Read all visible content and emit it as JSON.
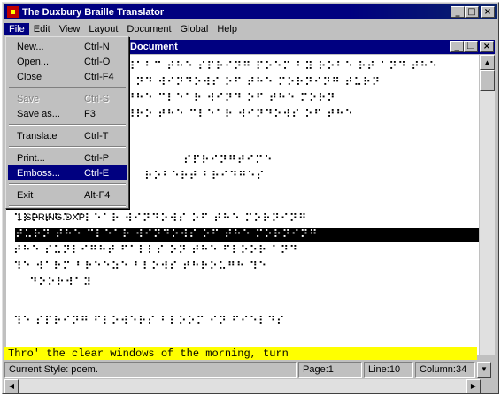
{
  "window": {
    "title": "The Duxbury Braille Translator",
    "minimize": "_",
    "maximize": "□",
    "close": "×"
  },
  "menubar": {
    "items": [
      "File",
      "Edit",
      "View",
      "Layout",
      "Document",
      "Global",
      "Help"
    ]
  },
  "file_menu": {
    "items": [
      {
        "label": "New...",
        "shortcut": "Ctrl-N",
        "state": "normal"
      },
      {
        "label": "Open...",
        "shortcut": "Ctrl-O",
        "state": "normal"
      },
      {
        "label": "Close",
        "shortcut": "Ctrl-F4",
        "state": "normal"
      },
      {
        "label": "Save",
        "shortcut": "Ctrl-S",
        "state": "disabled"
      },
      {
        "label": "Save as...",
        "shortcut": "F3",
        "state": "normal"
      },
      {
        "label": "Translate",
        "shortcut": "Ctrl-T",
        "state": "normal"
      },
      {
        "label": "Print...",
        "shortcut": "Ctrl-P",
        "state": "normal"
      },
      {
        "label": "Emboss...",
        "shortcut": "Ctrl-E",
        "state": "selected"
      },
      {
        "label": "Exit",
        "shortcut": "Alt-F4",
        "state": "normal"
      },
      {
        "label": "1 SPRING.DXP",
        "shortcut": "",
        "state": "normal"
      }
    ]
  },
  "document": {
    "title_suffix": "Document",
    "minimize": "_",
    "restore": "❐",
    "close": "×",
    "braille_lines": [
      "⠼⠁⠃⠉ ⠞⠓⠑ ⠎⠏⠗⠊⠝⠛ ⠏⠕⠑⠍ ⠃⠽ ⠗⠕⠃⠑ ⠗⠞ ⠁⠝⠙ ⠞⠓⠑",
      "⠁⠝⠙ ⠺⠊⠝⠙⠕⠺⠎ ⠕⠋ ⠞⠓⠑ ⠍⠕⠗⠝⠊⠝⠛ ⠞⠥⠗⠝",
      "⠞⠓⠑ ⠉⠇⠑⠁⠗ ⠺⠊⠝⠙ ⠕⠋ ⠞⠓⠑ ⠍⠕⠗⠝",
      "⠹⠗⠕ ⠞⠓⠑ ⠉⠇⠑⠁⠗ ⠺⠊⠝⠙⠕⠺⠎ ⠕⠋ ⠞⠓⠑",
      "⠎⠏⠗⠊⠝⠛⠞⠊⠍⠑",
      "⠗⠕⠃⠑⠗⠞ ⠃⠗⠊⠙⠛⠑⠎",
      "⠹⠗⠕ ⠞⠓⠑ ⠉⠇⠑⠁⠗ ⠺⠊⠝⠙⠕⠺⠎ ⠕⠋ ⠞⠓⠑ ⠍⠕⠗⠝⠊⠝⠛",
      "⠞⠥⠗⠝ ⠞⠓⠑ ⠉⠇⠑⠁⠗ ⠺⠊⠝⠙⠕⠺⠎ ⠕⠋ ⠞⠓⠑ ⠍⠕⠗⠝⠊⠝⠛",
      "⠞⠓⠑ ⠎⠥⠝⠇⠊⠛⠓⠞ ⠋⠁⠇⠇⠎ ⠕⠝ ⠞⠓⠑ ⠋⠇⠕⠕⠗ ⠁⠝⠙",
      "⠹⠑ ⠺⠁⠗⠍ ⠃⠗⠑⠑⠵⠑ ⠃⠇⠕⠺⠎ ⠞⠓⠗⠕⠥⠛⠓ ⠹⠑",
      "⠙⠕⠕⠗⠺⠁⠽",
      "⠹⠑ ⠎⠏⠗⠊⠝⠛ ⠋⠇⠕⠺⠑⠗⠎ ⠃⠇⠕⠕⠍ ⠊⠝ ⠋⠊⠑⠇⠙⠎"
    ],
    "print_line": "Thro' the clear windows of the morning, turn"
  },
  "statusbar": {
    "style": "Current Style: poem.",
    "page": "Page:1",
    "line": "Line:10",
    "column": "Column:34"
  },
  "scroll": {
    "up": "▲",
    "down": "▼",
    "left": "◀",
    "right": "▶"
  },
  "colors": {
    "titlebar": "#000080",
    "highlight_line": "#000000",
    "print_line_bg": "#ffff00"
  }
}
